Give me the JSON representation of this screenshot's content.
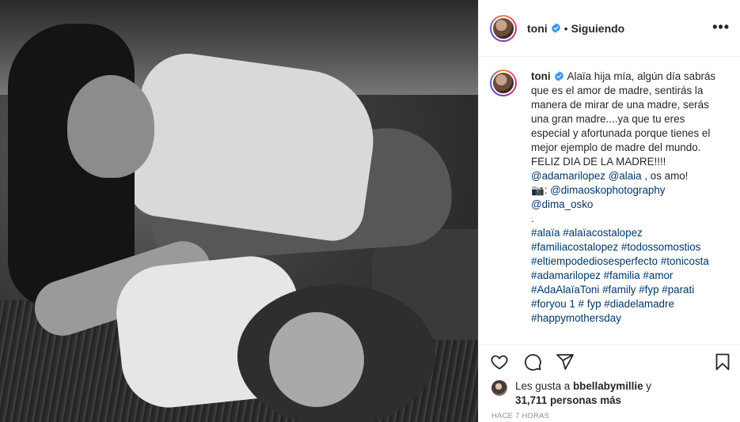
{
  "post": {
    "username": "toni",
    "separator": "•",
    "follow_status": "Siguiendo",
    "more_label": "•••",
    "caption_lines": [
      "Alaïa hija mía, algún día sabrás",
      "que es el amor de madre, sentirás la",
      "manera de mirar de una madre, serás",
      "una gran madre....ya que tu eres",
      "especial y afortunada porque tienes el",
      "mejor ejemplo de madre del mundo.",
      "FELIZ DIA DE LA MADRE!!!!"
    ],
    "mentions_line": {
      "mention1": "@adamarilopez",
      "mention2": "@alaia",
      "suffix": " , os amo!"
    },
    "photo_credit": {
      "emoji": "📷",
      "prefix": ": ",
      "mention1": "@dimaoskophotography",
      "mention2": "@dima_osko"
    },
    "dot_line": ".",
    "hashtag_lines": [
      "#alaïa #alaïacostalopez",
      "#familiacostalopez #todossomostios",
      "#eltiempodediosesperfecto #tonicosta",
      "#adamarilopez #familia #amor",
      "#AdaAlaïaToni #family #fyp #parati",
      "#foryou 1 # fyp #diadelamadre",
      "#happymothersday"
    ],
    "likes": {
      "prefix": "Les gusta a ",
      "user": "bbellabymillie",
      "connector": " y",
      "count": "31,711 personas más"
    },
    "time_ago": "HACE 7 HORAS"
  },
  "colors": {
    "verified": "#3897f0",
    "link": "#00376b",
    "muted": "#8e8e8e",
    "border": "#efefef"
  },
  "icons": [
    "heart-icon",
    "comment-icon",
    "share-icon",
    "bookmark-icon",
    "verified-badge-icon",
    "more-icon"
  ]
}
